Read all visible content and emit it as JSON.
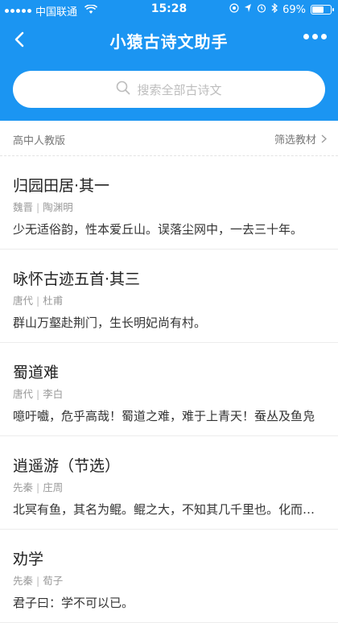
{
  "status_bar": {
    "carrier": "中国联通",
    "time": "15:28",
    "battery_percent": "69%",
    "battery_level": 0.69
  },
  "nav": {
    "title": "小猿古诗文助手"
  },
  "search": {
    "placeholder": "搜索全部古诗文"
  },
  "filter": {
    "edition": "高中人教版",
    "filter_label": "筛选教材"
  },
  "poems": [
    {
      "title": "归园田居·其一",
      "dynasty": "魏晋",
      "author": "陶渊明",
      "excerpt": "少无适俗韵，性本爱丘山。误落尘网中，一去三十年。"
    },
    {
      "title": "咏怀古迹五首·其三",
      "dynasty": "唐代",
      "author": "杜甫",
      "excerpt": "群山万壑赴荆门，生长明妃尚有村。"
    },
    {
      "title": "蜀道难",
      "dynasty": "唐代",
      "author": "李白",
      "excerpt": "噫吁嚱，危乎高哉！蜀道之难，难于上青天！蚕丛及鱼凫"
    },
    {
      "title": "逍遥游（节选）",
      "dynasty": "先秦",
      "author": "庄周",
      "excerpt": "北冥有鱼，其名为鲲。鲲之大，不知其几千里也。化而为鸟"
    },
    {
      "title": "劝学",
      "dynasty": "先秦",
      "author": "荀子",
      "excerpt": "君子曰：学不可以已。"
    }
  ],
  "colors": {
    "header_bg": "#1b95f2",
    "text_primary": "#222222",
    "text_secondary": "#999999"
  },
  "icons": [
    "signal-icon",
    "wifi-icon",
    "location-icon",
    "navigation-icon",
    "alarm-icon",
    "bluetooth-icon",
    "battery-icon",
    "back-arrow-icon",
    "more-dots-icon",
    "search-icon",
    "chevron-right-icon"
  ]
}
